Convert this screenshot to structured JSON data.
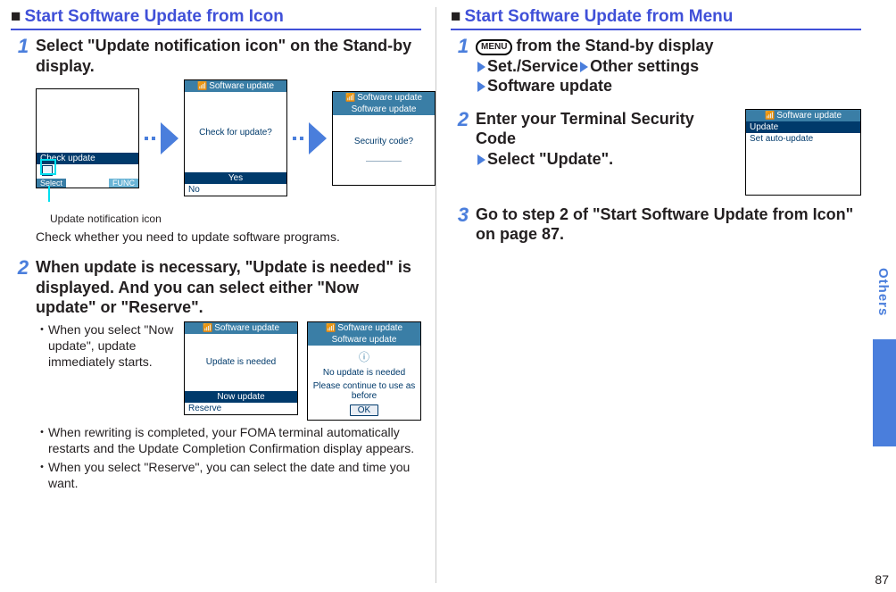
{
  "left": {
    "heading": "Start Software Update from Icon",
    "step1": {
      "title": "Select \"Update notification icon\" on the Stand-by display.",
      "screen_a": {
        "bar": "Check update",
        "soft_select": "Select",
        "soft_func": "FUNC"
      },
      "screen_b": {
        "title": "Software update",
        "body": "Check for update?",
        "yes": "Yes",
        "no": "No"
      },
      "screen_c": {
        "title": "Software update",
        "sub": "Software update",
        "body": "Security code?",
        "blank": "＿＿＿＿"
      },
      "caption": "Update notification icon",
      "note": "Check whether you need to update software programs."
    },
    "step2": {
      "title": "When update is necessary, \"Update is needed\" is displayed. And you can select either \"Now update\" or \"Reserve\".",
      "bullets": [
        "When you select \"Now update\", update immediately starts.",
        "When rewriting is completed, your FOMA terminal automatically restarts and the Update Completion Confirmation display appears.",
        "When you select \"Reserve\", you can select the date and time you want."
      ],
      "screen_a": {
        "title": "Software update",
        "body": "Update is needed",
        "opt1": "Now update",
        "opt2": "Reserve"
      },
      "screen_b": {
        "title": "Software update",
        "sub": "Software update",
        "line1": "No update is needed",
        "line2": "Please continue to use as before",
        "ok": "OK"
      }
    }
  },
  "right": {
    "heading": "Start Software Update from Menu",
    "step1": {
      "menu_label": "MENU",
      "after_menu": "from the Stand-by display",
      "path1": "Set./Service",
      "path2": "Other settings",
      "path3": "Software update"
    },
    "step2": {
      "line1": "Enter your Terminal Security Code",
      "line2": "Select \"Update\".",
      "screen": {
        "title": "Software update",
        "row1": "Update",
        "row2": "Set auto-update"
      }
    },
    "step3": {
      "title": "Go to step 2 of \"Start Software Update from Icon\" on page 87."
    }
  },
  "side_label": "Others",
  "page_number": "87"
}
